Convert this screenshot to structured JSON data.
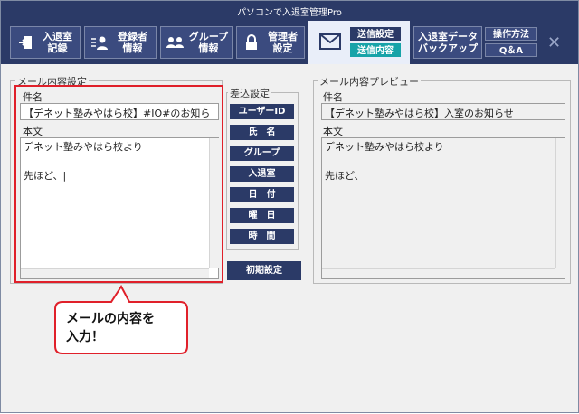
{
  "window": {
    "title": "パソコンで入退室管理Pro",
    "close_icon": "close-icon"
  },
  "toolbar": {
    "entry_line1": "入退室",
    "entry_line2": "記録",
    "register_line1": "登録者",
    "register_line2": "情報",
    "group_line1": "グループ",
    "group_line2": "情報",
    "admin_line1": "管理者",
    "admin_line2": "設定",
    "send_settings": "送信設定",
    "send_content": "送信内容",
    "backup_line1": "入退室データ",
    "backup_line2": "バックアップ",
    "help": "操作方法",
    "qa": "Q＆A"
  },
  "mail_settings": {
    "group_title": "メール内容設定",
    "subject_label": "件名",
    "subject_value": "【デネット塾みやはら校】#IO#のお知ら",
    "body_label": "本文",
    "body_value": "デネット塾みやはら校より\n\n先ほど、|"
  },
  "insert": {
    "group_title": "差込設定",
    "buttons": [
      "ユーザーID",
      "氏　名",
      "グループ",
      "入退室",
      "日　付",
      "曜　日",
      "時　間"
    ],
    "reset": "初期設定"
  },
  "preview": {
    "group_title": "メール内容プレビュー",
    "subject_label": "件名",
    "subject_value": "【デネット塾みやはら校】入室のお知らせ",
    "body_label": "本文",
    "body_value": "デネット塾みやはら校より\n\n先ほど、"
  },
  "callout": {
    "line1": "メールの内容を",
    "line2": "入力！"
  },
  "colors": {
    "navy": "#2b3a67",
    "teal": "#17a3a8",
    "red": "#e0202a"
  }
}
